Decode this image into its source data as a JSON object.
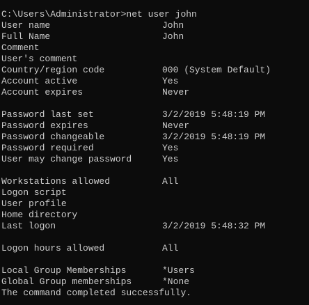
{
  "console": {
    "text_color": "#cccccc",
    "background_color": "#0c0c0c",
    "lines": [
      {
        "text": "C:\\Users\\Administrator>net user john"
      },
      {
        "key": "User name",
        "value": "John"
      },
      {
        "key": "Full Name",
        "value": "John"
      },
      {
        "key": "Comment",
        "value": ""
      },
      {
        "key": "User's comment",
        "value": ""
      },
      {
        "key": "Country/region code",
        "value": "000 (System Default)"
      },
      {
        "key": "Account active",
        "value": "Yes"
      },
      {
        "key": "Account expires",
        "value": "Never"
      },
      {
        "text": ""
      },
      {
        "key": "Password last set",
        "value": "3/2/2019 5:48:19 PM"
      },
      {
        "key": "Password expires",
        "value": "Never"
      },
      {
        "key": "Password changeable",
        "value": "3/2/2019 5:48:19 PM"
      },
      {
        "key": "Password required",
        "value": "Yes"
      },
      {
        "key": "User may change password",
        "value": "Yes"
      },
      {
        "text": ""
      },
      {
        "key": "Workstations allowed",
        "value": "All"
      },
      {
        "key": "Logon script",
        "value": ""
      },
      {
        "key": "User profile",
        "value": ""
      },
      {
        "key": "Home directory",
        "value": ""
      },
      {
        "key": "Last logon",
        "value": "3/2/2019 5:48:32 PM"
      },
      {
        "text": ""
      },
      {
        "key": "Logon hours allowed",
        "value": "All"
      },
      {
        "text": ""
      },
      {
        "key": "Local Group Memberships",
        "value": "*Users"
      },
      {
        "key": "Global Group memberships",
        "value": "*None"
      },
      {
        "text": "The command completed successfully."
      }
    ]
  }
}
